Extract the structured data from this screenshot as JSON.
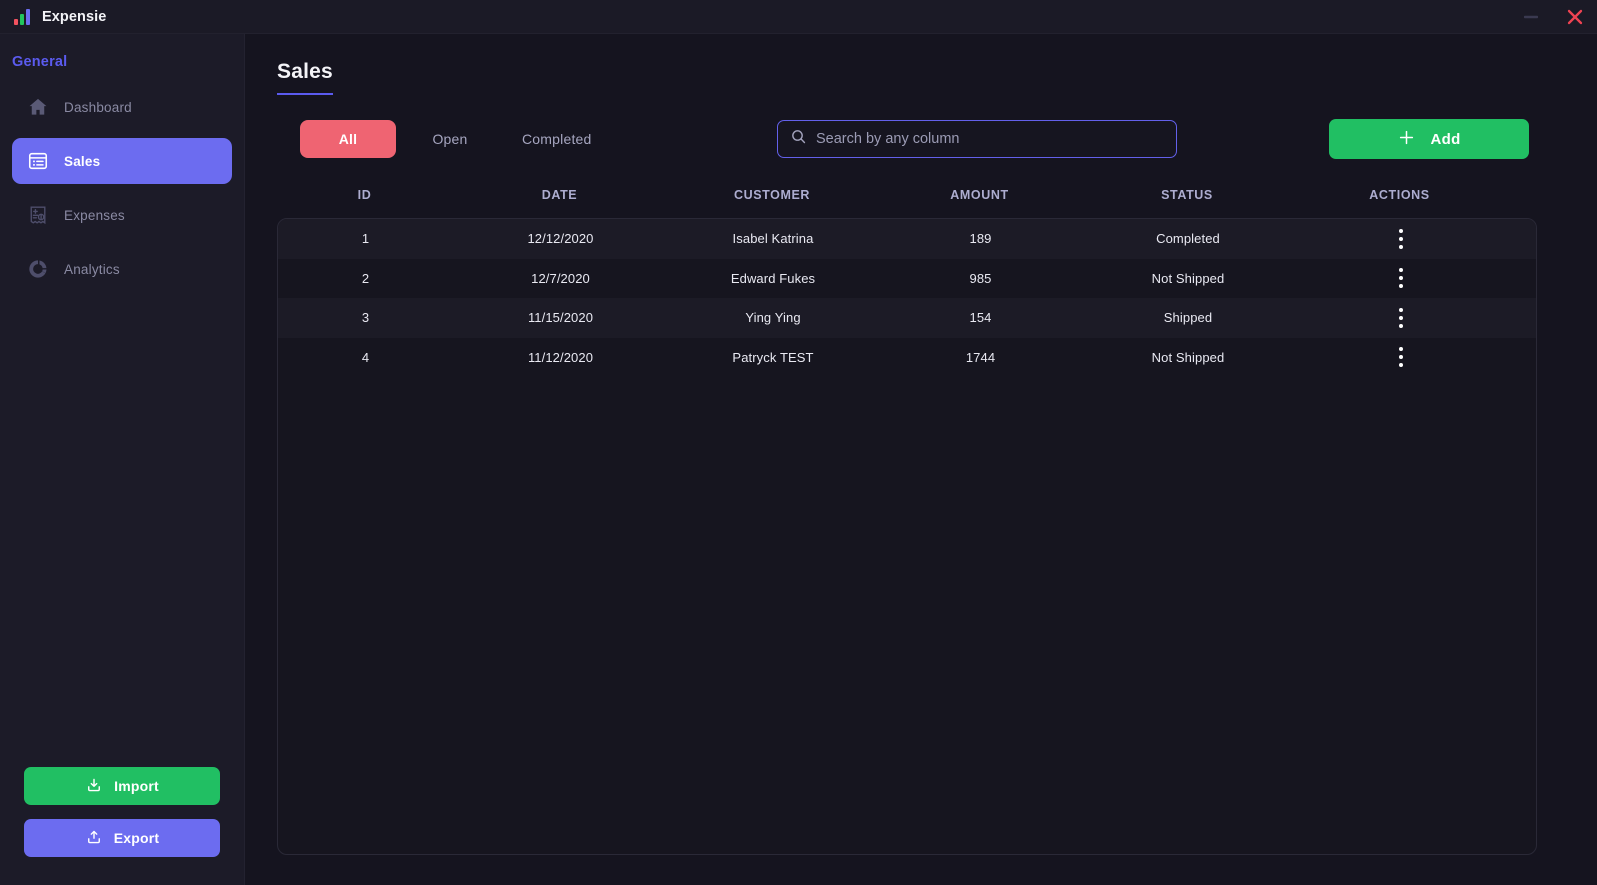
{
  "window": {
    "app_title": "Expensie",
    "logo_icon": "bar-chart-logo-icon",
    "minimize_label": "Minimize",
    "close_label": "Close",
    "colors": {
      "accent_purple": "#6c6cf0",
      "accent_green": "#21bf63",
      "accent_red": "#ef6472",
      "close_red": "#ef4352",
      "sidebar_bg": "#1c1b28",
      "main_bg": "#15141f",
      "row_odd": "#1c1b26",
      "row_even": "#16151f"
    }
  },
  "sidebar": {
    "section_title": "General",
    "items": [
      {
        "label": "Dashboard",
        "icon": "home-icon",
        "active": false
      },
      {
        "label": "Sales",
        "icon": "list-icon",
        "active": true
      },
      {
        "label": "Expenses",
        "icon": "receipt-icon",
        "active": false
      },
      {
        "label": "Analytics",
        "icon": "donut-chart-icon",
        "active": false
      }
    ],
    "import_label": "Import",
    "import_icon": "import-tray-icon",
    "export_label": "Export",
    "export_icon": "export-tray-icon"
  },
  "main": {
    "page_title": "Sales",
    "tabs": [
      {
        "label": "All",
        "active": true
      },
      {
        "label": "Open",
        "active": false
      },
      {
        "label": "Completed",
        "active": false
      }
    ],
    "search": {
      "placeholder": "Search by any column",
      "value": "",
      "icon": "search-icon"
    },
    "add_label": "Add",
    "add_icon": "plus-icon",
    "table": {
      "columns": [
        "ID",
        "DATE",
        "CUSTOMER",
        "AMOUNT",
        "STATUS",
        "ACTIONS"
      ],
      "rows": [
        {
          "id": "1",
          "date": "12/12/2020",
          "customer": "Isabel Katrina",
          "amount": "189",
          "status": "Completed"
        },
        {
          "id": "2",
          "date": "12/7/2020",
          "customer": "Edward Fukes",
          "amount": "985",
          "status": "Not Shipped"
        },
        {
          "id": "3",
          "date": "11/15/2020",
          "customer": "Ying Ying",
          "amount": "154",
          "status": "Shipped"
        },
        {
          "id": "4",
          "date": "11/12/2020",
          "customer": "Patryck TEST",
          "amount": "1744",
          "status": "Not Shipped"
        }
      ],
      "row_action_icon": "kebab-menu-icon"
    }
  }
}
